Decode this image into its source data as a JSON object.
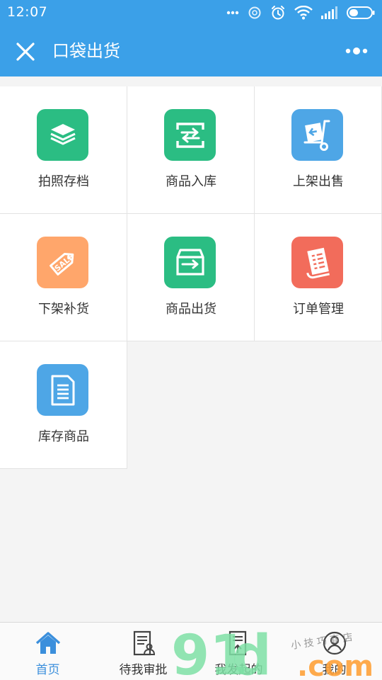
{
  "status_bar": {
    "time": "12:07",
    "icons": [
      "dots-icon",
      "data-saver-icon",
      "alarm-icon",
      "wifi-icon",
      "signal-icon",
      "battery-icon"
    ]
  },
  "header": {
    "title": "口袋出货",
    "close_icon": "close-icon",
    "more_icon": "more-icon"
  },
  "colors": {
    "header_bg": "#3ba0e8",
    "green": "#2bbd83",
    "blue": "#4ea6e6",
    "orange": "#ffa66b",
    "red": "#f26c5b",
    "nav_active": "#3b8fdc"
  },
  "grid": {
    "items": [
      {
        "label": "拍照存档",
        "icon": "stack-icon",
        "color": "#2bbd83"
      },
      {
        "label": "商品入库",
        "icon": "box-transfer-icon",
        "color": "#2bbd83"
      },
      {
        "label": "上架出售",
        "icon": "hand-truck-icon",
        "color": "#4ea6e6"
      },
      {
        "label": "下架补货",
        "icon": "sale-tag-icon",
        "color": "#ffa66b"
      },
      {
        "label": "商品出货",
        "icon": "box-export-icon",
        "color": "#2bbd83"
      },
      {
        "label": "订单管理",
        "icon": "receipt-icon",
        "color": "#f26c5b"
      },
      {
        "label": "库存商品",
        "icon": "document-icon",
        "color": "#4ea6e6"
      }
    ]
  },
  "bottom_nav": {
    "items": [
      {
        "label": "首页",
        "icon": "home-icon",
        "active": true
      },
      {
        "label": "待我审批",
        "icon": "approve-doc-icon",
        "active": false
      },
      {
        "label": "我发起的",
        "icon": "sent-doc-icon",
        "active": false
      },
      {
        "label": "我的",
        "icon": "user-icon",
        "active": false
      }
    ]
  },
  "watermark": {
    "brand": "9",
    "brand_text": "91",
    "brand_mid": "d",
    "domain": ".com",
    "script": "小 技 巧 商 店"
  }
}
